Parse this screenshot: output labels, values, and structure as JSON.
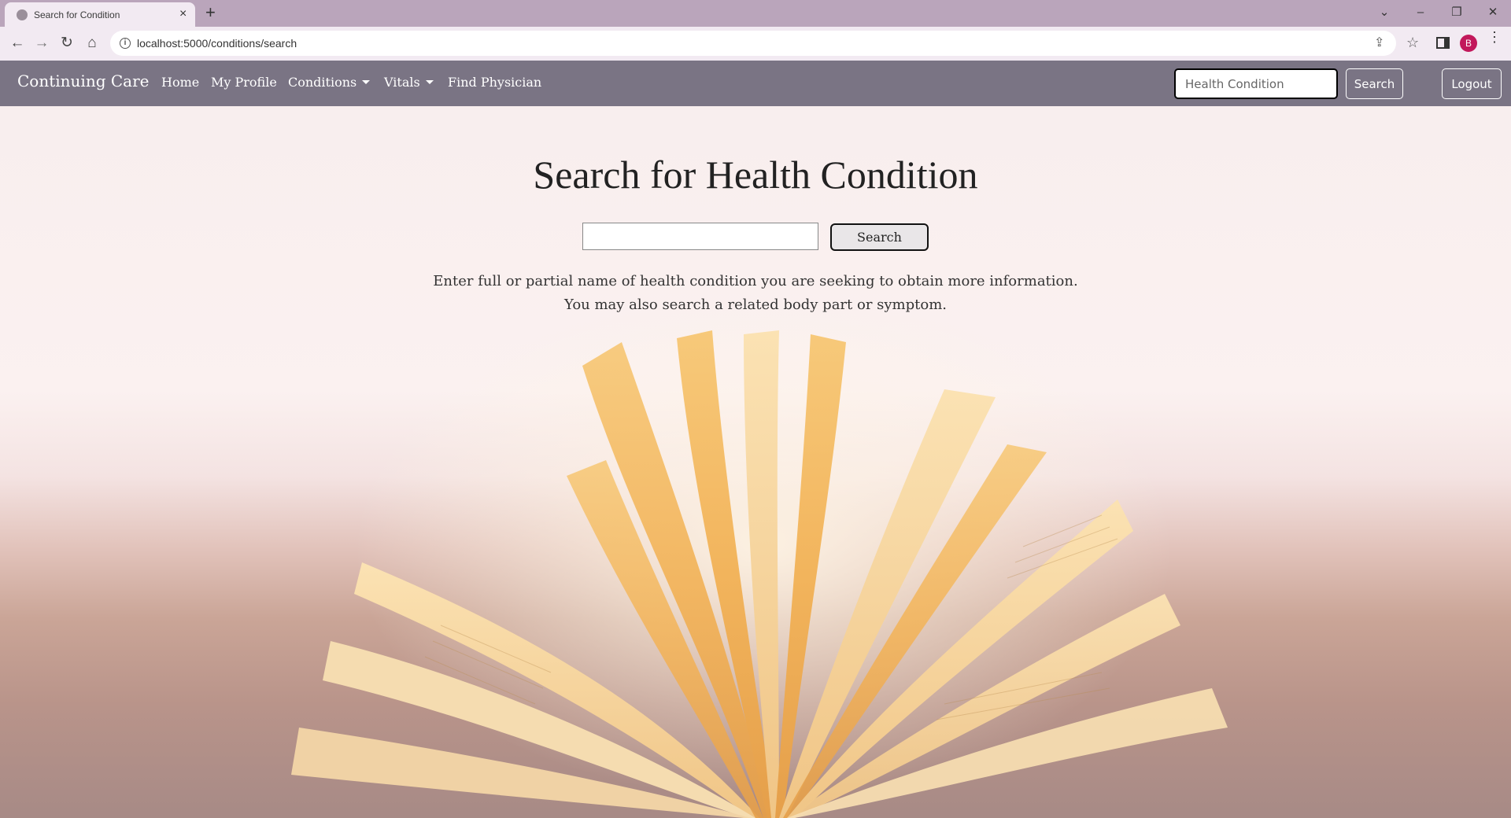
{
  "browser": {
    "tab_title": "Search for Condition",
    "tab_close": "×",
    "new_tab": "+",
    "url": "localhost:5000/conditions/search",
    "profile_initial": "B",
    "window_controls": {
      "chevron": "⌄",
      "minimize": "–",
      "restore": "❐",
      "close": "✕"
    },
    "nav": {
      "back": "←",
      "forward": "→",
      "reload": "↻",
      "home": "⌂"
    },
    "omnibox_icons": {
      "info": "i",
      "share": "⇪",
      "star": "☆"
    },
    "menu": "⋮"
  },
  "navbar": {
    "brand": "Continuing Care",
    "links": {
      "home": "Home",
      "profile": "My Profile",
      "conditions": "Conditions",
      "vitals": "Vitals",
      "find_physician": "Find Physician"
    },
    "search_placeholder": "Health Condition",
    "search_button": "Search",
    "logout_button": "Logout",
    "bg_color": "#7a7484"
  },
  "main": {
    "title": "Search for Health Condition",
    "search_input_value": "",
    "search_button": "Search",
    "help_line1": "Enter full or partial name of health condition you are seeking to obtain more information.",
    "help_line2": "You may also search a related body part or symptom.",
    "background_image": "open-book-image"
  }
}
